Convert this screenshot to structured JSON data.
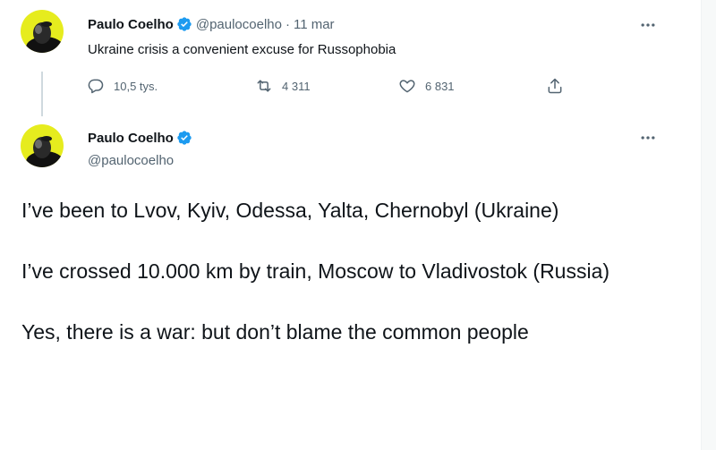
{
  "tweet1": {
    "author_name": "Paulo Coelho",
    "handle": "@paulocoelho",
    "separator": "·",
    "time": "11 mar",
    "text": "Ukraine crisis a convenient excuse for Russophobia",
    "actions": {
      "replies": "10,5 tys.",
      "retweets": "4 311",
      "likes": "6 831"
    }
  },
  "tweet2": {
    "author_name": "Paulo Coelho",
    "handle": "@paulocoelho",
    "paragraphs": [
      "I’ve been to Lvov, Kyiv, Odessa, Yalta, Chernobyl (Ukraine)",
      "I’ve crossed 10.000 km by train, Moscow to Vladivostok (Russia)",
      "Yes, there is a war: but don’t blame the common people"
    ]
  },
  "colors": {
    "verified": "#1d9bf0",
    "secondary_text": "#536471",
    "primary_text": "#0f1419",
    "avatar_bg": "#e6ec1e"
  },
  "icons": [
    "verified-badge-icon",
    "more-icon",
    "reply-icon",
    "retweet-icon",
    "like-icon",
    "share-icon"
  ]
}
